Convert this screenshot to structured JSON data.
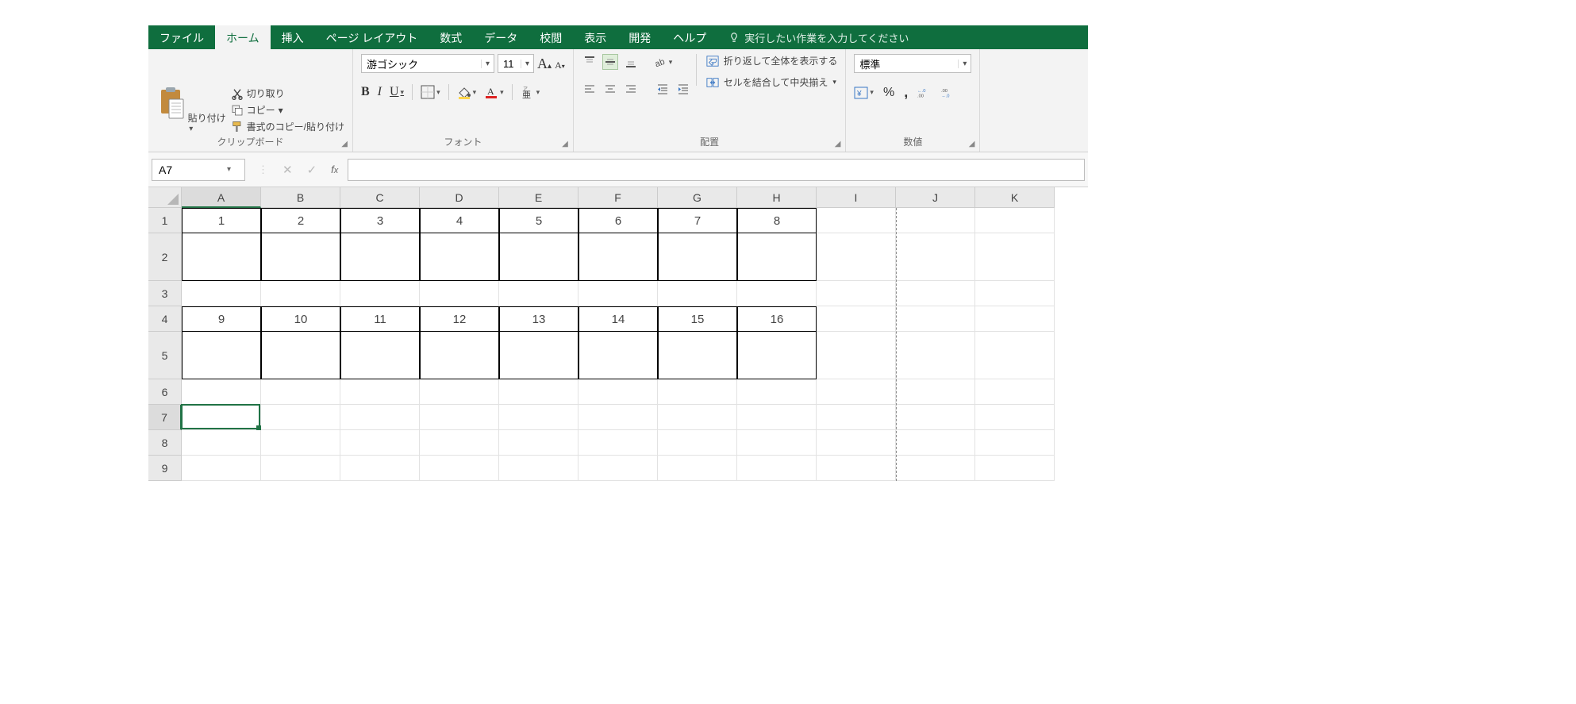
{
  "tabs": {
    "file": "ファイル",
    "home": "ホーム",
    "insert": "挿入",
    "page_layout": "ページ レイアウト",
    "formulas": "数式",
    "data": "データ",
    "review": "校閲",
    "view": "表示",
    "developer": "開発",
    "help": "ヘルプ",
    "tell_me": "実行したい作業を入力してください"
  },
  "clipboard": {
    "paste": "貼り付け",
    "cut": "切り取り",
    "copy": "コピー",
    "format_painter": "書式のコピー/貼り付け",
    "group_label": "クリップボード"
  },
  "font": {
    "name": "游ゴシック",
    "size": "11",
    "group_label": "フォント"
  },
  "alignment": {
    "wrap_text": "折り返して全体を表示する",
    "merge_center": "セルを結合して中央揃え",
    "group_label": "配置"
  },
  "number": {
    "format": "標準",
    "group_label": "数値"
  },
  "namebox": "A7",
  "formula": "",
  "columns": [
    "A",
    "B",
    "C",
    "D",
    "E",
    "F",
    "G",
    "H",
    "I",
    "J",
    "K"
  ],
  "active_column": "A",
  "active_row": 7,
  "rows": [
    {
      "n": 1,
      "h": "normal",
      "cells": [
        "1",
        "2",
        "3",
        "4",
        "5",
        "6",
        "7",
        "8",
        "",
        "",
        ""
      ],
      "bordered": true,
      "topRow": true
    },
    {
      "n": 2,
      "h": "tall",
      "cells": [
        "",
        "",
        "",
        "",
        "",
        "",
        "",
        "",
        "",
        "",
        ""
      ],
      "bordered": true,
      "bottomRow": true
    },
    {
      "n": 3,
      "h": "normal",
      "cells": [
        "",
        "",
        "",
        "",
        "",
        "",
        "",
        "",
        "",
        "",
        ""
      ]
    },
    {
      "n": 4,
      "h": "normal",
      "cells": [
        "9",
        "10",
        "11",
        "12",
        "13",
        "14",
        "15",
        "16",
        "",
        "",
        ""
      ],
      "bordered": true,
      "topRow": true
    },
    {
      "n": 5,
      "h": "tall",
      "cells": [
        "",
        "",
        "",
        "",
        "",
        "",
        "",
        "",
        "",
        "",
        ""
      ],
      "bordered": true,
      "bottomRow": true
    },
    {
      "n": 6,
      "h": "normal",
      "cells": [
        "",
        "",
        "",
        "",
        "",
        "",
        "",
        "",
        "",
        "",
        ""
      ]
    },
    {
      "n": 7,
      "h": "normal",
      "cells": [
        "",
        "",
        "",
        "",
        "",
        "",
        "",
        "",
        "",
        "",
        ""
      ]
    },
    {
      "n": 8,
      "h": "normal",
      "cells": [
        "",
        "",
        "",
        "",
        "",
        "",
        "",
        "",
        "",
        "",
        ""
      ]
    },
    {
      "n": 9,
      "h": "normal",
      "cells": [
        "",
        "",
        "",
        "",
        "",
        "",
        "",
        "",
        "",
        "",
        ""
      ]
    }
  ],
  "border_cols": 8,
  "page_break_after_col": 9
}
